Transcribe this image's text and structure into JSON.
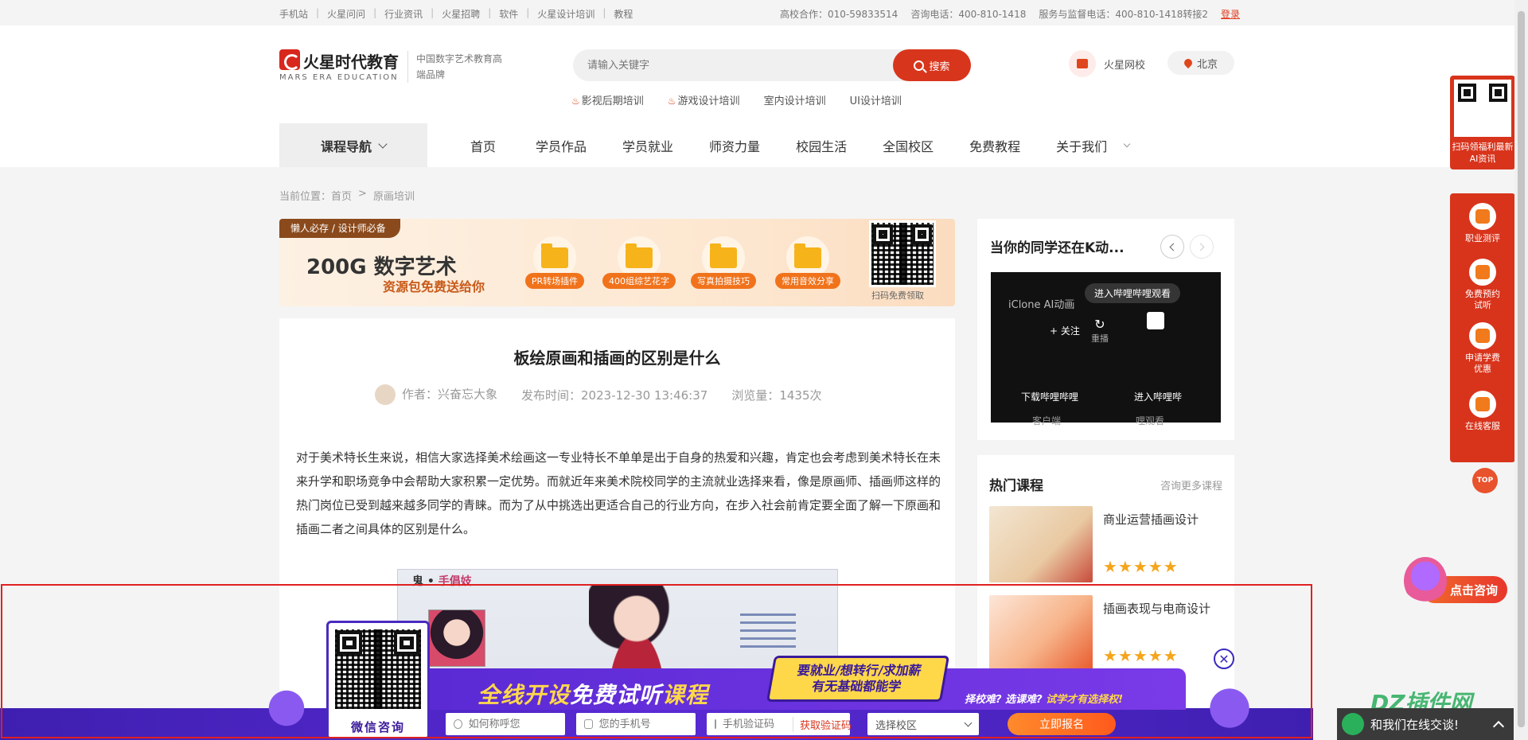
{
  "topbar": {
    "links": [
      "手机站",
      "火星问问",
      "行业资讯",
      "火星招聘",
      "软件",
      "火星设计培训",
      "教程"
    ],
    "hotline1": "高校合作：010-59833514",
    "hotline2": "咨询电话：400-810-1418",
    "hotline3": "服务与监督电话：400-810-1418转接2",
    "login": "登录"
  },
  "header": {
    "logo_cn": "火星时代教育",
    "logo_en": "MARS ERA EDUCATION",
    "slogan": "中国数字艺术教育高端品牌",
    "search_placeholder": "请输入关键字",
    "search_button": "搜索",
    "hot_keywords": [
      "影视后期培训",
      "游戏设计培训",
      "室内设计培训",
      "UI设计培训"
    ],
    "school_link": "火星网校",
    "city": "北京"
  },
  "nav": {
    "course_nav": "课程导航",
    "items": [
      "首页",
      "学员作品",
      "学员就业",
      "师资力量",
      "校园生活",
      "全国校区",
      "免费教程",
      "关于我们"
    ]
  },
  "breadcrumb": {
    "label": "当前位置：",
    "home": "首页",
    "sep": ">",
    "current": "原画培训"
  },
  "banner": {
    "tag": "懒人必存 / 设计师必备",
    "headline": "200G 数字艺术",
    "sub": "资源包免费送给你",
    "folders": [
      "PR转场插件",
      "400组综艺花字",
      "写真拍摄技巧",
      "常用音效分享"
    ],
    "qr_caption": "扫码免费领取"
  },
  "article": {
    "title": "板绘原画和插画的区别是什么",
    "author": "作者：兴奋忘大象",
    "date": "发布时间：2023-12-30 13:46:37",
    "views": "浏览量：1435次",
    "body": "对于美术特长生来说，相信大家选择美术绘画这一专业特长不单单是出于自身的热爱和兴趣，肯定也会考虑到美术特长在未来升学和职场竞争中会帮助大家积累一定优势。而就近年来美术院校同学的主流就业选择来看，像是原画师、插画师这样的热门岗位已受到越来越多同学的青睐。而为了从中挑选出更适合自己的行业方向，在步入社会前肯定要全面了解一下原画和插画二者之间具体的区别是什么。",
    "image_heading_prefix": "鬼 •",
    "image_heading_name": "手倡妓"
  },
  "video": {
    "title": "当你的同学还在K动...",
    "overlay_title": "iClone AI动画",
    "enter": "进入哔哩哔哩观看",
    "follow": "+ 关注",
    "replay": "重播",
    "download": "下载哔哩哔哩",
    "enter_short": "进入哔哩哔",
    "bottom1": "客户端",
    "bottom2": "哩观看"
  },
  "hot_courses": {
    "title": "热门课程",
    "more": "咨询更多课程",
    "items": [
      {
        "name": "商业运营插画设计",
        "stars": "★★★★★"
      },
      {
        "name": "插画表现与电商设计",
        "stars": "★★★★★"
      }
    ]
  },
  "sidebar": {
    "qr_caption": "扫码领福利最新AI资讯",
    "items": [
      "职业测评",
      "免费预约试听",
      "申请学费优惠",
      "在线客服"
    ],
    "top": "TOP",
    "consult": "点击咨询"
  },
  "promo": {
    "title_a": "全线开设",
    "title_b": "免费试听",
    "title_c": "课程",
    "box_line1": "要就业/想转行/求加薪",
    "box_line2": "有无基础都能学",
    "slogan_a": "择校难? 选课难? ",
    "slogan_b": "试学才有选择权!",
    "qr_caption": "微信咨询",
    "name_placeholder": "如何称呼您",
    "phone_placeholder": "您的手机号",
    "code_placeholder": "手机验证码",
    "get_code": "获取验证码",
    "campus_select": "选择校区",
    "submit": "立即报名"
  },
  "chat": {
    "text": "和我们在线交谈!"
  },
  "watermark": "DZ插件网",
  "colors": {
    "brand_red": "#d8341c",
    "promo_purple": "#5a2ad4",
    "star": "#f5a51c"
  }
}
